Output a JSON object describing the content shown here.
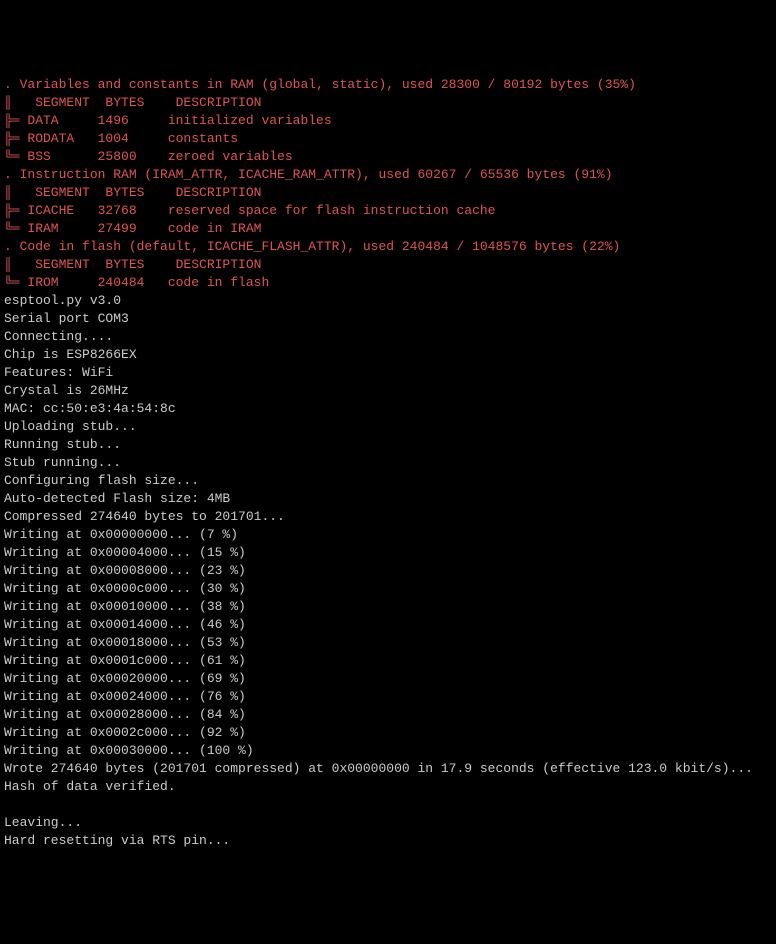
{
  "sections": [
    {
      "header_label": ". Variables and constants in RAM (global, static), used 28300 / 80192 bytes (35%)",
      "col_header_seg": "SEGMENT",
      "col_header_bytes": "BYTES",
      "col_header_desc": "DESCRIPTION",
      "rows": [
        {
          "seg": "DATA",
          "bytes": "1496",
          "desc": "initialized variables"
        },
        {
          "seg": "RODATA",
          "bytes": "1004",
          "desc": "constants"
        },
        {
          "seg": "BSS",
          "bytes": "25800",
          "desc": "zeroed variables"
        }
      ]
    },
    {
      "header_label": ". Instruction RAM (IRAM_ATTR, ICACHE_RAM_ATTR), used 60267 / 65536 bytes (91%)",
      "col_header_seg": "SEGMENT",
      "col_header_bytes": "BYTES",
      "col_header_desc": "DESCRIPTION",
      "rows": [
        {
          "seg": "ICACHE",
          "bytes": "32768",
          "desc": "reserved space for flash instruction cache"
        },
        {
          "seg": "IRAM",
          "bytes": "27499",
          "desc": "code in IRAM"
        }
      ]
    },
    {
      "header_label": ". Code in flash (default, ICACHE_FLASH_ATTR), used 240484 / 1048576 bytes (22%)",
      "col_header_seg": "SEGMENT",
      "col_header_bytes": "BYTES",
      "col_header_desc": "DESCRIPTION",
      "rows": [
        {
          "seg": "IROM",
          "bytes": "240484",
          "desc": "code in flash"
        }
      ]
    }
  ],
  "tool_lines": [
    "esptool.py v3.0",
    "Serial port COM3",
    "Connecting....",
    "Chip is ESP8266EX",
    "Features: WiFi",
    "Crystal is 26MHz",
    "MAC: cc:50:e3:4a:54:8c",
    "Uploading stub...",
    "Running stub...",
    "Stub running...",
    "Configuring flash size...",
    "Auto-detected Flash size: 4MB",
    "Compressed 274640 bytes to 201701...",
    "Writing at 0x00000000... (7 %)",
    "Writing at 0x00004000... (15 %)",
    "Writing at 0x00008000... (23 %)",
    "Writing at 0x0000c000... (30 %)",
    "Writing at 0x00010000... (38 %)",
    "Writing at 0x00014000... (46 %)",
    "Writing at 0x00018000... (53 %)",
    "Writing at 0x0001c000... (61 %)",
    "Writing at 0x00020000... (69 %)",
    "Writing at 0x00024000... (76 %)",
    "Writing at 0x00028000... (84 %)",
    "Writing at 0x0002c000... (92 %)",
    "Writing at 0x00030000... (100 %)",
    "Wrote 274640 bytes (201701 compressed) at 0x00000000 in 17.9 seconds (effective 123.0 kbit/s)...",
    "Hash of data verified.",
    "",
    "Leaving...",
    "Hard resetting via RTS pin..."
  ],
  "glyphs": {
    "pipe": "║",
    "tee": "╠═",
    "elbow": "╚═"
  }
}
